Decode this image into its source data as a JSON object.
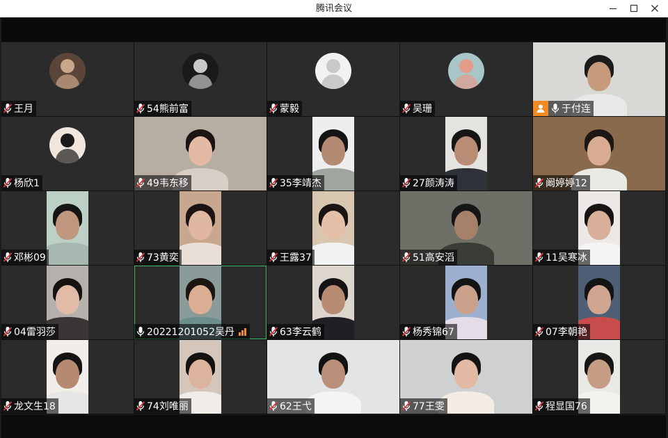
{
  "window": {
    "title": "腾讯会议"
  },
  "participants": [
    {
      "name": "王月",
      "mic": "muted",
      "avatar": "photo",
      "avatar_color": "#5a4538",
      "avatar_accent": "#c9a58a"
    },
    {
      "name": "54熊前富",
      "mic": "muted",
      "avatar": "photo",
      "avatar_color": "#1a1a1a",
      "avatar_accent": "#c8c8c8"
    },
    {
      "name": "蒙毅",
      "mic": "muted",
      "avatar": "default"
    },
    {
      "name": "吴珊",
      "mic": "muted",
      "avatar": "photo",
      "avatar_color": "#a8c6c8",
      "avatar_accent": "#e39b8a"
    },
    {
      "name": "于付连",
      "mic": "on",
      "host": true,
      "video": true,
      "bg": "#d8d8d4",
      "skin": "#c79a7c",
      "hair": "#1b1b1b",
      "shirt": "#e8e8e8"
    },
    {
      "name": "杨欣1",
      "mic": "muted",
      "avatar": "photo",
      "avatar_color": "#f1e6dc",
      "avatar_accent": "#1a1a1a"
    },
    {
      "name": "49韦东移",
      "mic": "muted",
      "video": true,
      "bg": "#b7aea3",
      "skin": "#e2b9a3",
      "hair": "#1a1512",
      "shirt": "#d7cec6"
    },
    {
      "name": "35李靖杰",
      "mic": "muted",
      "video": true,
      "bg": "#eeeeee",
      "skin": "#b38a72",
      "hair": "#141414",
      "shirt": "#9fa6a0"
    },
    {
      "name": "27颜涛涛",
      "mic": "muted",
      "video": true,
      "bg": "#e5e3e0",
      "skin": "#b88d74",
      "hair": "#161616",
      "shirt": "#2e3138"
    },
    {
      "name": "阚婷婷12",
      "mic": "muted",
      "video": true,
      "bg": "#8a6a4c",
      "skin": "#d9ab92",
      "hair": "#1d1714",
      "shirt": "#e9eae4"
    },
    {
      "name": "邓彬09",
      "mic": "muted",
      "video": true,
      "bg": "#bcd0c6",
      "skin": "#bf977e",
      "hair": "#151515",
      "shirt": "#a7b8b0"
    },
    {
      "name": "73黄奕",
      "mic": "muted",
      "video": true,
      "bg": "#c7a88f",
      "skin": "#e0b7a0",
      "hair": "#1b1412",
      "shirt": "#eadfd6"
    },
    {
      "name": "王露37",
      "mic": "muted",
      "video": true,
      "bg": "#d9c6b0",
      "skin": "#e4c0a8",
      "hair": "#1a1512",
      "shirt": "#f2f2f2"
    },
    {
      "name": "51高安滔",
      "mic": "muted",
      "video": true,
      "bg": "#6e7067",
      "skin": "#a78069",
      "hair": "#161616",
      "shirt": "#3a3c37"
    },
    {
      "name": "11吴寒冰",
      "mic": "muted",
      "video": true,
      "bg": "#ece8e6",
      "skin": "#d8b09a",
      "hair": "#181414",
      "shirt": "#f4f4f4"
    },
    {
      "name": "04雷羽莎",
      "mic": "muted",
      "video": true,
      "bg": "#b6b0ad",
      "skin": "#e1bba6",
      "hair": "#161210",
      "shirt": "#3a3636"
    },
    {
      "name": "20221201052吴丹",
      "mic": "on",
      "speaking": true,
      "video": true,
      "bg": "#8a9b9a",
      "skin": "#dcae94",
      "hair": "#1c1512",
      "shirt": "#6b8f8c"
    },
    {
      "name": "63李云鹤",
      "mic": "muted",
      "video": true,
      "bg": "#ddd6cf",
      "skin": "#b88c72",
      "hair": "#141414",
      "shirt": "#1f1f24"
    },
    {
      "name": "杨秀锦67",
      "mic": "muted",
      "video": true,
      "bg": "#9db0cf",
      "skin": "#c9a18a",
      "hair": "#141414",
      "shirt": "#e4dde8"
    },
    {
      "name": "07李朝艳",
      "mic": "muted",
      "video": true,
      "bg": "#4f5f76",
      "skin": "#d0a690",
      "hair": "#141414",
      "shirt": "#c84c4c"
    },
    {
      "name": "龙文生18",
      "mic": "muted",
      "video": true,
      "bg": "#f1eeea",
      "skin": "#b58a70",
      "hair": "#141414",
      "shirt": "#e6e6e6"
    },
    {
      "name": "74刘唯丽",
      "mic": "muted",
      "video": true,
      "bg": "#d5c6bb",
      "skin": "#dcb39c",
      "hair": "#161210",
      "shirt": "#f0ede9"
    },
    {
      "name": "62王弋",
      "mic": "muted",
      "video": true,
      "bg": "#e2e4e5",
      "skin": "#b9907a",
      "hair": "#121212",
      "shirt": "#f4f4f4"
    },
    {
      "name": "77王雯",
      "mic": "muted",
      "video": true,
      "bg": "#cfd0d2",
      "skin": "#e2b9a3",
      "hair": "#141212",
      "shirt": "#f4ede6"
    },
    {
      "name": "程显国76",
      "mic": "muted",
      "video": true,
      "bg": "#e9e9e6",
      "skin": "#c59c84",
      "hair": "#161616",
      "shirt": "#f2f2ee"
    }
  ]
}
